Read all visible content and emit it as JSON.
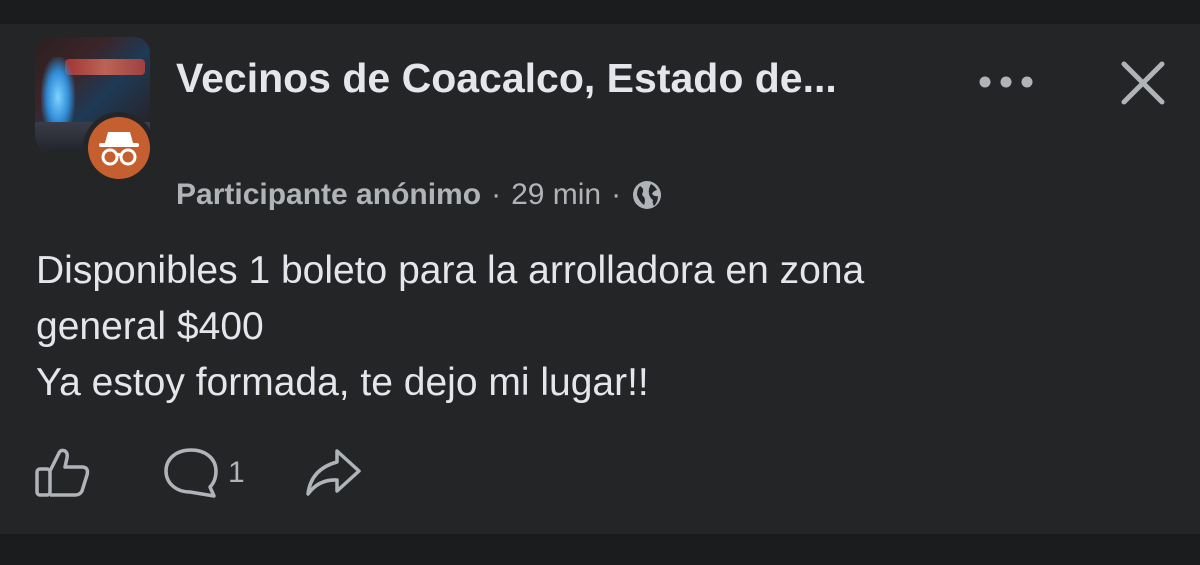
{
  "post": {
    "group_name": "Vecinos de Coacalco, Estado de...",
    "author": "Participante anónimo",
    "separator": "·",
    "time": "29 min",
    "privacy_icon": "globe-icon",
    "body_lines": [
      "Disponibles 1 boleto para la arrolladora en zona",
      "general $400",
      "Ya estoy formada, te dejo mi lugar!!"
    ],
    "comment_count": "1"
  },
  "icons": {
    "more": "more-dots-icon",
    "close": "close-icon",
    "like": "thumbs-up-icon",
    "comment": "comment-icon",
    "share": "share-icon",
    "anonymous": "incognito-icon"
  },
  "colors": {
    "background": "#242527",
    "text_primary": "#e4e6eb",
    "text_secondary": "#b0b3b8",
    "anon_badge": "#c55f2f"
  }
}
